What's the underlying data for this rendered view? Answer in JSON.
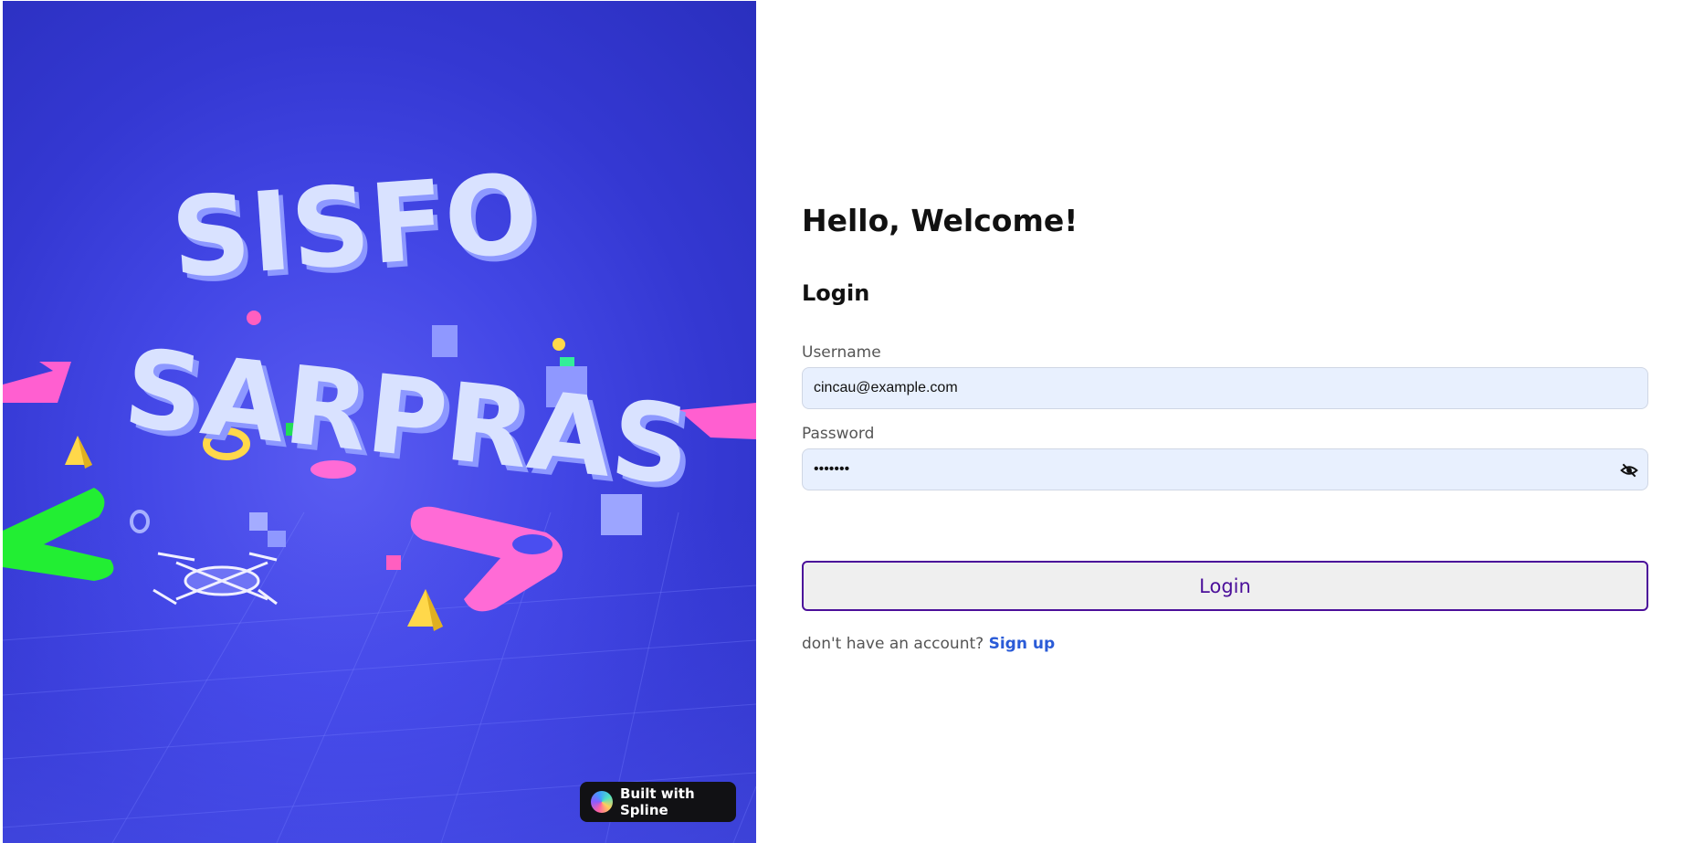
{
  "hero": {
    "title_line1": "SISFO",
    "title_line2": "SARPRAS",
    "badge_label": "Built with Spline",
    "badge_icon": "spline-logo-icon",
    "background_color": "#3a3ed8"
  },
  "form": {
    "greeting": "Hello, Welcome!",
    "heading": "Login",
    "username": {
      "label": "Username",
      "value": "cincau@example.com"
    },
    "password": {
      "label": "Password",
      "value": "•••••••",
      "toggle_icon": "eye-off-icon"
    },
    "submit_label": "Login",
    "signup_prompt": "don't have an account?",
    "signup_link": "Sign up"
  },
  "colors": {
    "accent": "#4b0f9a",
    "link": "#2a5bd7",
    "input_bg": "#e8f0fe"
  }
}
